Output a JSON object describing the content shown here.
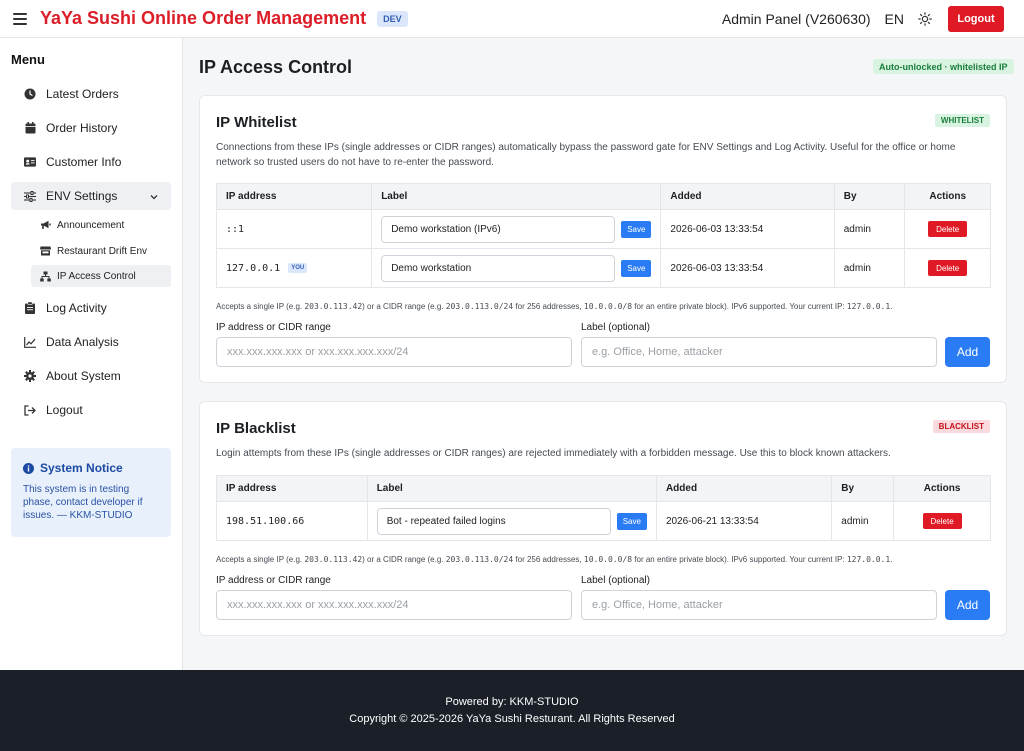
{
  "header": {
    "brand": "YaYa Sushi Online Order Management",
    "env_badge": "DEV",
    "admin_panel": "Admin Panel (V260630)",
    "language": "EN",
    "logout_label": "Logout"
  },
  "sidebar": {
    "menu_title": "Menu",
    "items": [
      {
        "label": "Latest Orders",
        "icon": "clock-icon"
      },
      {
        "label": "Order History",
        "icon": "calendar-icon"
      },
      {
        "label": "Customer Info",
        "icon": "id-card-icon"
      },
      {
        "label": "ENV Settings",
        "icon": "sliders-icon"
      },
      {
        "label": "Log Activity",
        "icon": "clipboard-icon"
      },
      {
        "label": "Data Analysis",
        "icon": "chart-line-icon"
      },
      {
        "label": "About System",
        "icon": "gear-icon"
      },
      {
        "label": "Logout",
        "icon": "sign-out-icon"
      }
    ],
    "sub_items": [
      {
        "label": "Announcement",
        "icon": "megaphone-icon"
      },
      {
        "label": "Restaurant Drift Env",
        "icon": "store-icon"
      },
      {
        "label": "IP Access Control",
        "icon": "network-icon"
      }
    ],
    "notice": {
      "title": "System Notice",
      "text": "This system is in testing phase, contact developer if issues. — KKM-STUDIO"
    }
  },
  "main": {
    "title": "IP Access Control",
    "auto_badge": "Auto-unlocked · whitelisted IP",
    "whitelist": {
      "title": "IP Whitelist",
      "tag": "WHITELIST",
      "description": "Connections from these IPs (single addresses or CIDR ranges) automatically bypass the password gate for ENV Settings and Log Activity. Useful for the office or home network so trusted users do not have to re-enter the password.",
      "columns": [
        "IP address",
        "Label",
        "Added",
        "By",
        "Actions"
      ],
      "rows": [
        {
          "ip": "::1",
          "you": "",
          "label": "Demo workstation (IPv6)",
          "added": "2026-06-03 13:33:54",
          "by": "admin"
        },
        {
          "ip": "127.0.0.1",
          "you": "YOU",
          "label": "Demo workstation",
          "added": "2026-06-03 13:33:54",
          "by": "admin"
        }
      ]
    },
    "blacklist": {
      "title": "IP Blacklist",
      "tag": "BLACKLIST",
      "description": "Login attempts from these IPs (single addresses or CIDR ranges) are rejected immediately with a forbidden message. Use this to block known attackers.",
      "columns": [
        "IP address",
        "Label",
        "Added",
        "By",
        "Actions"
      ],
      "rows": [
        {
          "ip": "198.51.100.66",
          "label": "Bot - repeated failed logins",
          "added": "2026-06-21 13:33:54",
          "by": "admin"
        }
      ]
    },
    "hint": {
      "t1": "Accepts a single IP (e.g. ",
      "c1": "203.0.113.42",
      "t2": ") or a CIDR range (e.g. ",
      "c2": "203.0.113.0/24",
      "t3": " for 256 addresses, ",
      "c3": "10.0.0.0/8",
      "t4": " for an entire private block). IPv6 supported. Your current IP: ",
      "c4": "127.0.0.1",
      "t5": "."
    },
    "form": {
      "ip_label": "IP address or CIDR range",
      "ip_placeholder": "xxx.xxx.xxx.xxx or xxx.xxx.xxx.xxx/24",
      "label_label": "Label (optional)",
      "label_placeholder": "e.g. Office, Home, attacker",
      "add_label": "Add"
    },
    "save_label": "Save",
    "delete_label": "Delete"
  },
  "footer": {
    "line1": "Powered by: KKM-STUDIO",
    "line2": "Copyright © 2025-2026 YaYa Sushi Resturant. All Rights Reserved"
  },
  "colors": {
    "brand": "#dc1e28",
    "primary": "#2a7cf5",
    "danger": "#e01a25",
    "success_bg": "#d8f3e0",
    "footer_bg": "#1b1f27"
  }
}
